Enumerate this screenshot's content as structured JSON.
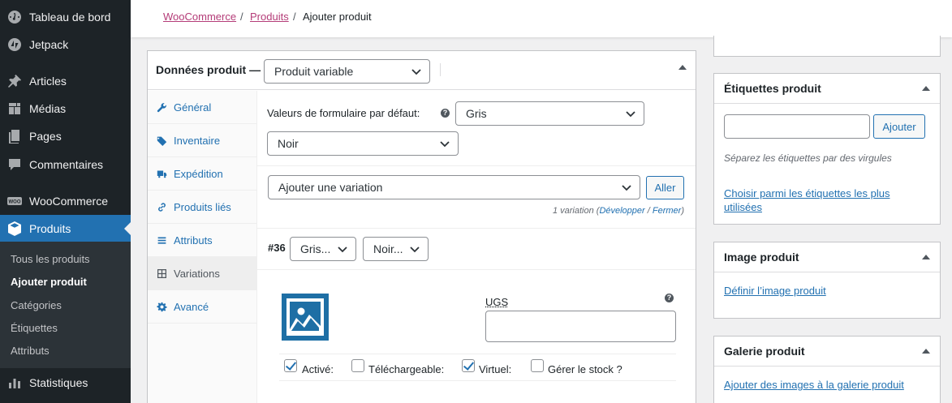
{
  "menu": {
    "items": [
      {
        "label": "Tableau de bord",
        "icon": "dashboard-icon"
      },
      {
        "label": "Jetpack",
        "icon": "jetpack-icon"
      },
      {
        "label": "Articles",
        "icon": "pin-icon"
      },
      {
        "label": "Médias",
        "icon": "media-icon"
      },
      {
        "label": "Pages",
        "icon": "page-icon"
      },
      {
        "label": "Commentaires",
        "icon": "comment-icon"
      },
      {
        "label": "WooCommerce",
        "icon": "woo-icon"
      },
      {
        "label": "Produits",
        "icon": "box-icon"
      },
      {
        "label": "Statistiques",
        "icon": "chart-icon"
      }
    ],
    "woo_badge": "WOO",
    "submenu": [
      "Tous les produits",
      "Ajouter produit",
      "Catégories",
      "Étiquettes",
      "Attributs"
    ]
  },
  "breadcrumb": {
    "woocommerce": "WooCommerce",
    "produits": "Produits",
    "sep": "/",
    "current": "Ajouter produit"
  },
  "product_data": {
    "title": "Données produit —",
    "type_value": "Produit variable",
    "tabs": [
      "Général",
      "Inventaire",
      "Expédition",
      "Produits liés",
      "Attributs",
      "Variations",
      "Avancé"
    ],
    "defaults_label": "Valeurs de formulaire par défaut:",
    "default_color": "Gris",
    "default_color2": "Noir",
    "add_variation_value": "Ajouter une variation",
    "go_button": "Aller",
    "variation_count": "1 variation (",
    "expand": "Développer",
    "slash": " / ",
    "close": "Fermer",
    "close_paren": ")",
    "variation_id": "#36",
    "var_attr1": "Gris...",
    "var_attr2": "Noir...",
    "sku_label": "UGS",
    "help_mark": "?",
    "checkboxes": [
      {
        "label": "Activé:",
        "checked": true
      },
      {
        "label": "Téléchargeable:",
        "checked": false
      },
      {
        "label": "Virtuel:",
        "checked": true
      },
      {
        "label": "Gérer le stock ?",
        "checked": false
      }
    ]
  },
  "tags_box": {
    "title": "Étiquettes produit",
    "add_button": "Ajouter",
    "hint": "Séparez les étiquettes par des virgules",
    "choose_link": "Choisir parmi les étiquettes les plus utilisées"
  },
  "image_box": {
    "title": "Image produit",
    "link": "Définir l’image produit"
  },
  "gallery_box": {
    "title": "Galerie produit",
    "link": "Ajouter des images à la galerie produit"
  },
  "colors": {
    "menu_bg": "#1d2327",
    "menu_active": "#2271b1",
    "link": "#2271b1",
    "woo_link": "#b43c78"
  }
}
